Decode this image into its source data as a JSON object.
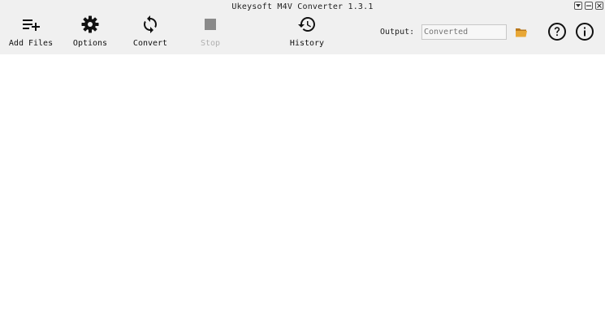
{
  "window": {
    "title": "Ukeysoft M4V Converter 1.3.1"
  },
  "toolbar": {
    "add_files": {
      "label": "Add Files",
      "icon": "playlist-add-icon"
    },
    "options": {
      "label": "Options",
      "icon": "gear-icon"
    },
    "convert": {
      "label": "Convert",
      "icon": "sync-icon"
    },
    "stop": {
      "label": "Stop",
      "icon": "stop-icon",
      "disabled": true
    },
    "history": {
      "label": "History",
      "icon": "history-icon"
    }
  },
  "output": {
    "label": "Output:",
    "value": "",
    "placeholder": "Converted"
  },
  "colors": {
    "toolbar_bg": "#f0f0f0",
    "folder": "#e0a030",
    "disabled_text": "#b0b0b0"
  }
}
